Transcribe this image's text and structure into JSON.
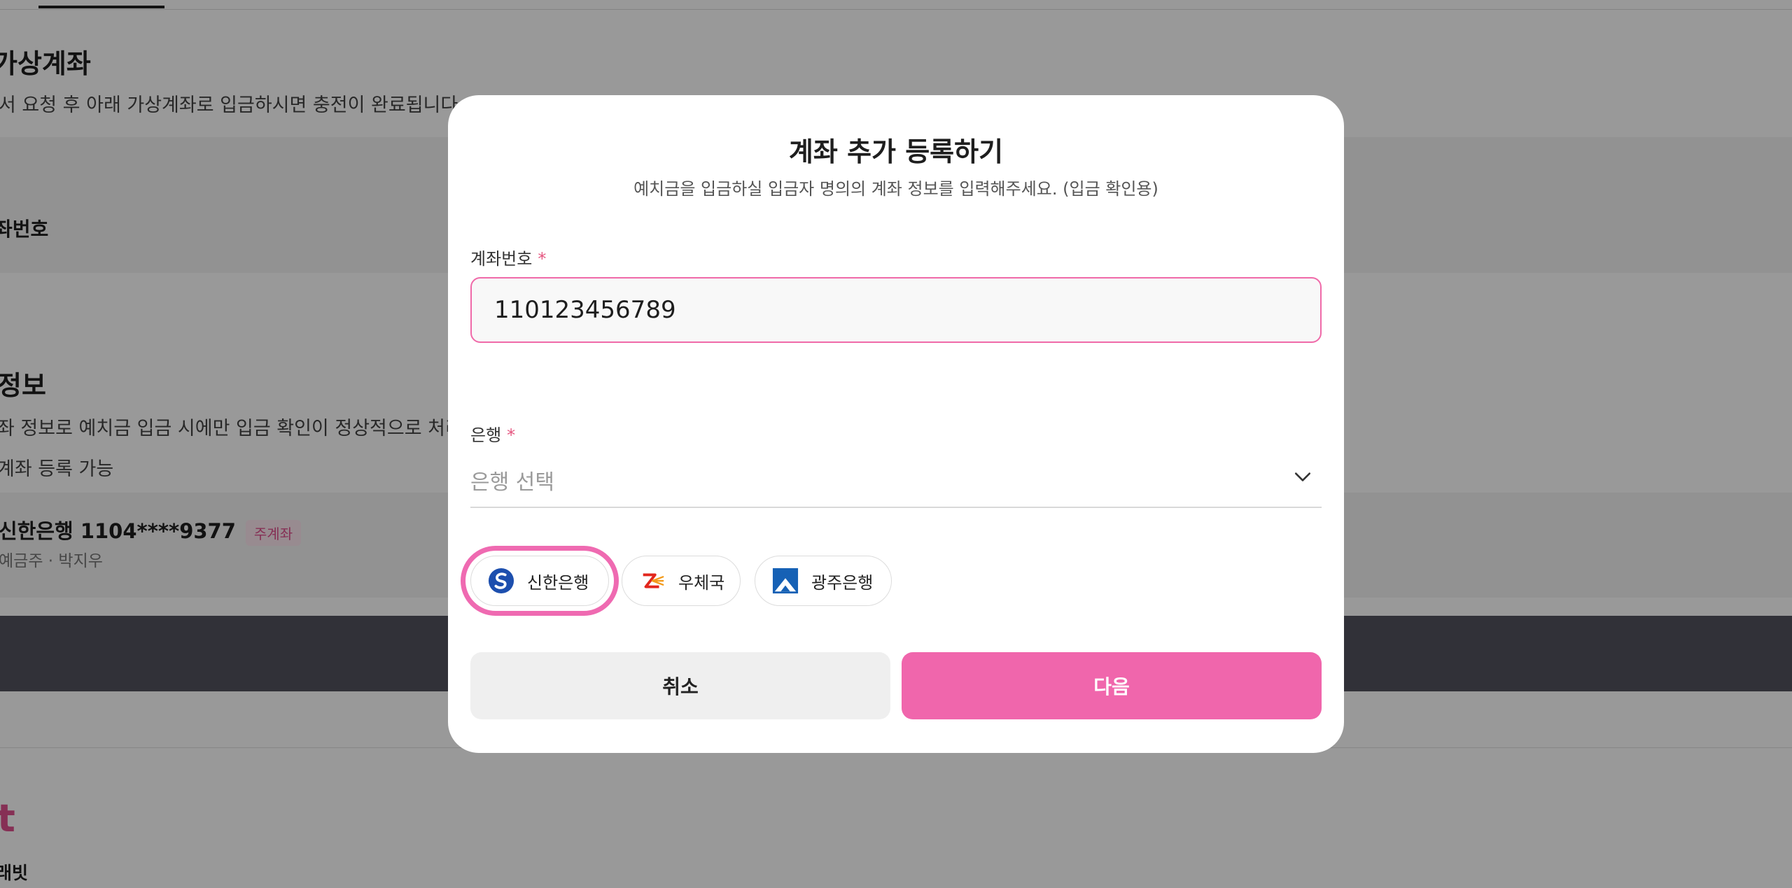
{
  "background": {
    "section1_title": "가상계좌",
    "section1_desc": "서 요청 후 아래 가상계좌로 입금하시면 충전이 완료됩니다.",
    "account_number_label": "좌번호",
    "section2_title": "정보",
    "section2_desc_line1": "좌 정보로 예치금 입금 시에만 입금 확인이 정상적으로 처리됩니다.",
    "section2_desc_line2": "계좌 등록 가능",
    "registered_account": "신한은행 1104****9377",
    "registered_account_badge": "주계좌",
    "registered_account_sub": "예금주 · 박지우",
    "footer_logo": "t",
    "footer_sub": "래빗"
  },
  "modal": {
    "title": "계좌 추가 등록하기",
    "subtitle": "예치금을 입금하실 입금자 명의의 계좌 정보를 입력해주세요. (입금 확인용)",
    "account_label": "계좌번호",
    "required_mark": "*",
    "account_value": "110123456789",
    "bank_label": "은행",
    "bank_placeholder": "은행 선택",
    "bank_chips": [
      {
        "label": "신한은행"
      },
      {
        "label": "우체국"
      },
      {
        "label": "광주은행"
      }
    ],
    "cancel_label": "취소",
    "next_label": "다음"
  },
  "colors": {
    "accent": "#f066ac",
    "required": "#e5557f",
    "input_border": "#f06aa9",
    "overlay": "rgba(0,0,0,0.4)"
  }
}
